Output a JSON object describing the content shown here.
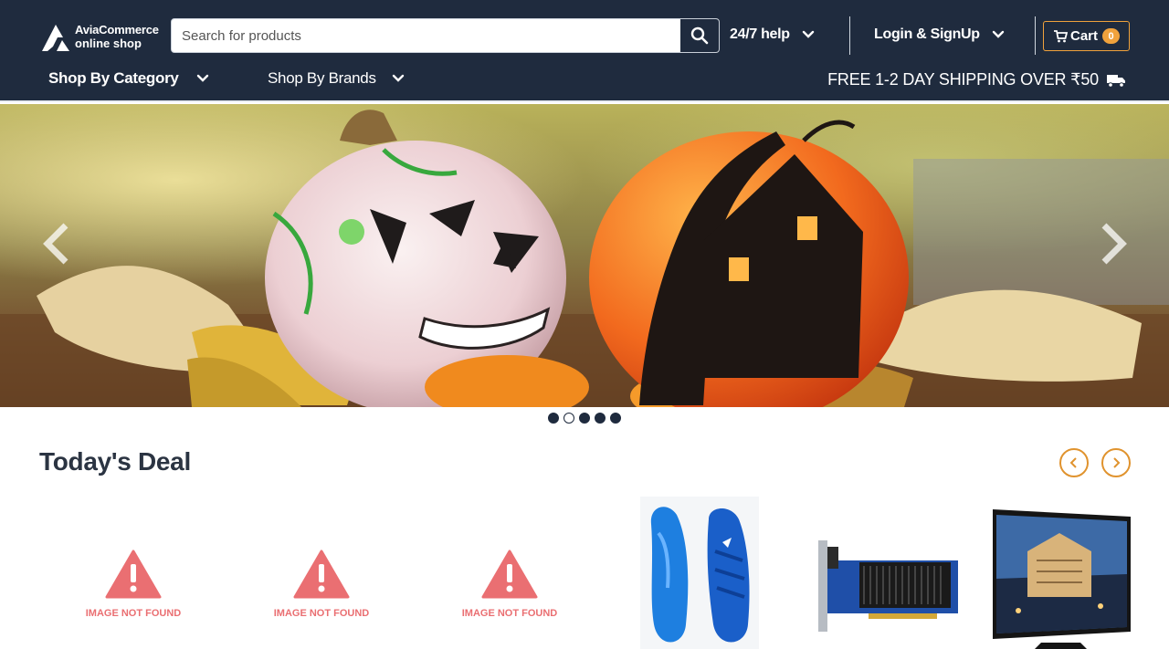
{
  "header": {
    "logo_line1": "AviaCommerce",
    "logo_line2": "online shop",
    "search_placeholder": "Search for products",
    "help_label": "24/7 help",
    "login_label": "Login & SignUp",
    "cart_label": "Cart",
    "cart_count": "0"
  },
  "nav": {
    "category_label": "Shop By Category",
    "brands_label": "Shop By Brands",
    "shipping_text": "FREE 1-2 DAY SHIPPING OVER ₹50"
  },
  "carousel": {
    "slide_count": 5,
    "active_slide": 2
  },
  "deals": {
    "title": "Today's Deal",
    "products": [
      {
        "image": "not-found",
        "label": "IMAGE NOT FOUND"
      },
      {
        "image": "not-found",
        "label": "IMAGE NOT FOUND"
      },
      {
        "image": "not-found",
        "label": "IMAGE NOT FOUND"
      },
      {
        "image": "blue-sports-shoes"
      },
      {
        "image": "graphics-card"
      },
      {
        "image": "curved-monitor"
      }
    ]
  },
  "colors": {
    "header_bg": "#1f2b3e",
    "accent": "#f0a23c",
    "not_found": "#ea6f72"
  }
}
